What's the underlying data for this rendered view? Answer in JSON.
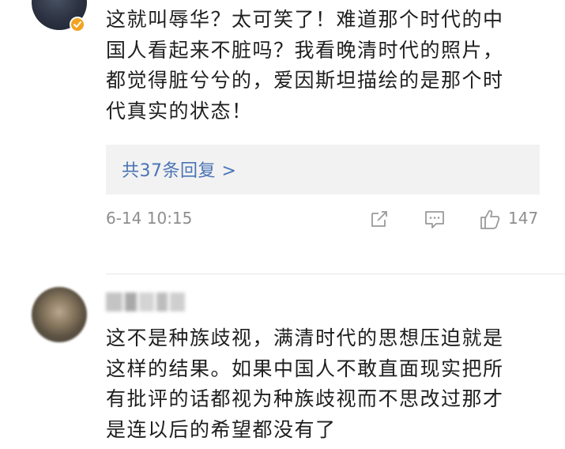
{
  "comments": [
    {
      "verified": true,
      "text": "这就叫辱华？太可笑了！难道那个时代的中\n国人看起来不脏吗？我看晚清时代的照片，\n都觉得脏兮兮的，爱因斯坦描绘的是那个时\n代真实的状态！",
      "reply_link": "共37条回复 >",
      "time": "6-14 10:15",
      "likes": "147"
    },
    {
      "text": "这不是种族歧视，满清时代的思想压迫就是\n这样的结果。如果中国人不敢直面现实把所\n有批评的话都视为种族歧视而不思改过那才\n是连以后的希望都没有了"
    }
  ],
  "colors": {
    "link": "#4a74b6",
    "meta": "#8e8e8e",
    "reply_bg": "#f2f2f2",
    "badge": "#f3a321"
  },
  "icons": [
    "share-icon",
    "comment-icon",
    "like-icon",
    "verified-badge-icon"
  ]
}
